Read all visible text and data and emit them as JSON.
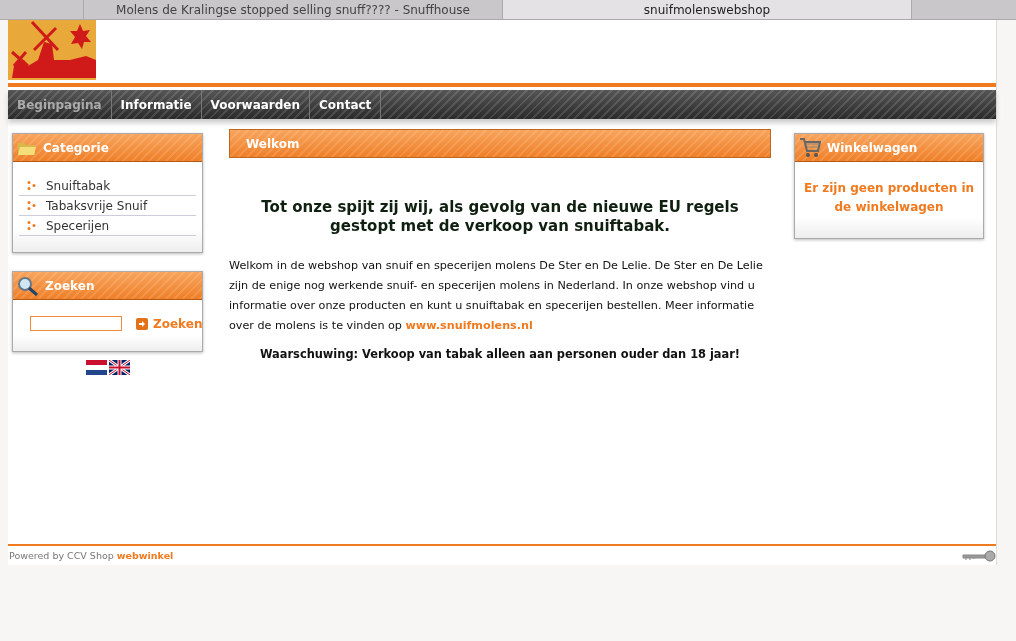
{
  "browser_tabs": [
    {
      "title": "Molens de Kralingse stopped selling snuff???? - Snuffhouse",
      "selected": false
    },
    {
      "title": "snuifmolenswebshop",
      "selected": true
    }
  ],
  "nav": [
    {
      "label": "Beginpagina",
      "selected": true
    },
    {
      "label": "Informatie",
      "selected": false
    },
    {
      "label": "Voorwaarden",
      "selected": false
    },
    {
      "label": "Contact",
      "selected": false
    }
  ],
  "categories": {
    "title": "Categorie",
    "items": [
      "Snuiftabak",
      "Tabaksvrije Snuif",
      "Specerijen"
    ]
  },
  "search": {
    "title": "Zoeken",
    "button": "Zoeken"
  },
  "main": {
    "title": "Welkom",
    "headline": "Tot onze spijt zij wij, als gevolg van de nieuwe EU regels gestopt met de verkoop van snuiftabak.",
    "intro": "Welkom in de webshop van snuif en specerijen molens De Ster en De Lelie. De Ster en De Lelie zijn de enige nog werkende snuif- en specerijen molens in Nederland. In onze webshop vind u informatie over onze producten en kunt u snuiftabak en specerijen bestellen. Meer informatie over de molens is te vinden op ",
    "link": "www.snuifmolens.nl",
    "warning": "Waarschuwing: Verkoop van tabak alleen aan personen ouder dan 18 jaar!"
  },
  "cart": {
    "title": "Winkelwagen",
    "message": "Er zijn geen producten in de winkelwagen"
  },
  "footer": {
    "text": "Powered by CCV Shop ",
    "link": "webwinkel"
  }
}
